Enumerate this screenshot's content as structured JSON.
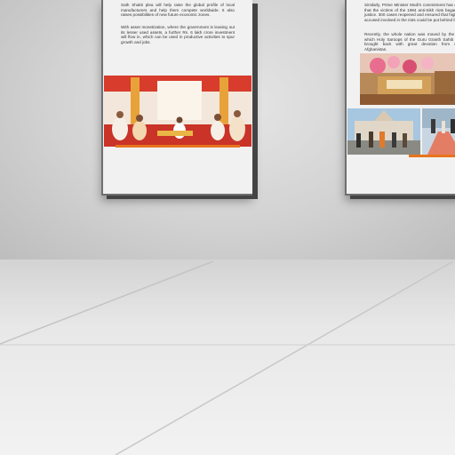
{
  "left_panel": {
    "paragraph_1": "Sath Shakti plea will help raise the global profile of local manufacturers and help them compete worldwide. It also raises possibilities of new future economic zones.",
    "paragraph_2": "With asset monetization, where the government is leasing out its lesser used assets, a further Rs. 6 lakh crore investment will flow in, which can be used in productive activities to spur growth and jobs.",
    "photo": "puja-ceremony-photo"
  },
  "right_panel": {
    "paragraph_1": "Similarly, Prime Minister Modi's commitment has ensured that the victims of the 1984 anti-Sikh riots began to get justice. 300 cases reopened and ensured that high-profile accused involved in the riots could be put behind bars.",
    "paragraph_2": "Recently, the whole nation was moved by the way in which Holy Saroops of the Guru Granth Sahib Ji were brought back with great devotion from war-torn Afghanistan.",
    "photos": [
      "gurdwara-interior-photo",
      "temple-visit-photo",
      "red-carpet-photo"
    ]
  },
  "colors": {
    "accent_orange": "#e8741e",
    "wall": "#d2d2d2",
    "panel_frame": "#444444"
  }
}
